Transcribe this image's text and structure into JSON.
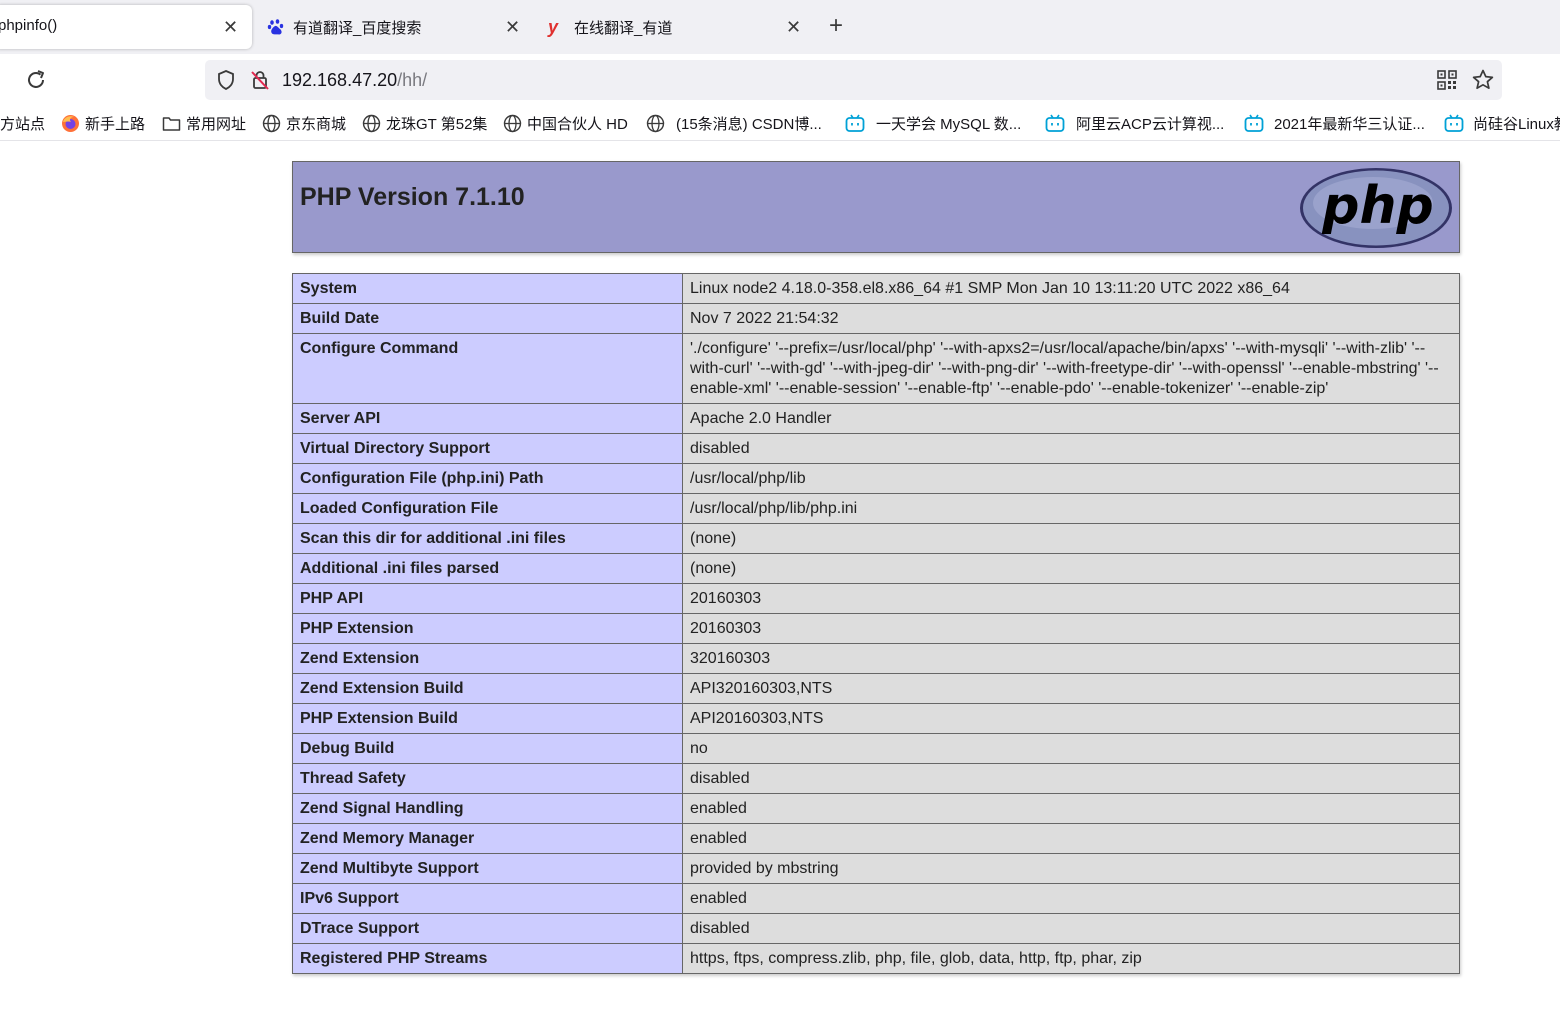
{
  "tabs": [
    {
      "title": "phpinfo()",
      "active": true
    },
    {
      "title": "有道翻译_百度搜索",
      "active": false
    },
    {
      "title": "在线翻译_有道",
      "active": false
    }
  ],
  "address": {
    "host": "192.168.47.20",
    "path": "/hh/"
  },
  "bookmarks": [
    {
      "label": "方站点",
      "icon": "none"
    },
    {
      "label": "新手上路",
      "icon": "firefox-icon"
    },
    {
      "label": "常用网址",
      "icon": "folder-icon"
    },
    {
      "label": "京东商城",
      "icon": "globe-icon"
    },
    {
      "label": "龙珠GT 第52集",
      "icon": "globe-icon"
    },
    {
      "label": "中国合伙人 HD",
      "icon": "globe-icon"
    },
    {
      "label": "(15条消息) CSDN博...",
      "icon": "globe-icon"
    },
    {
      "label": "一天学会 MySQL 数...",
      "icon": "bilibili-icon"
    },
    {
      "label": "阿里云ACP云计算视...",
      "icon": "bilibili-icon"
    },
    {
      "label": "2021年最新华三认证...",
      "icon": "bilibili-icon"
    },
    {
      "label": "尚硅谷Linux教",
      "icon": "bilibili-icon"
    }
  ],
  "php": {
    "title": "PHP Version 7.1.10",
    "logo_text": "php",
    "rows": [
      {
        "key": "System",
        "value": "Linux node2 4.18.0-358.el8.x86_64 #1 SMP Mon Jan 10 13:11:20 UTC 2022 x86_64"
      },
      {
        "key": "Build Date",
        "value": "Nov 7 2022 21:54:32"
      },
      {
        "key": "Configure Command",
        "value": "'./configure' '--prefix=/usr/local/php' '--with-apxs2=/usr/local/apache/bin/apxs' '--with-mysqli' '--with-zlib' '--with-curl' '--with-gd' '--with-jpeg-dir' '--with-png-dir' '--with-freetype-dir' '--with-openssl' '--enable-mbstring' '--enable-xml' '--enable-session' '--enable-ftp' '--enable-pdo' '--enable-tokenizer' '--enable-zip'"
      },
      {
        "key": "Server API",
        "value": "Apache 2.0 Handler"
      },
      {
        "key": "Virtual Directory Support",
        "value": "disabled"
      },
      {
        "key": "Configuration File (php.ini) Path",
        "value": "/usr/local/php/lib"
      },
      {
        "key": "Loaded Configuration File",
        "value": "/usr/local/php/lib/php.ini"
      },
      {
        "key": "Scan this dir for additional .ini files",
        "value": "(none)"
      },
      {
        "key": "Additional .ini files parsed",
        "value": "(none)"
      },
      {
        "key": "PHP API",
        "value": "20160303"
      },
      {
        "key": "PHP Extension",
        "value": "20160303"
      },
      {
        "key": "Zend Extension",
        "value": "320160303"
      },
      {
        "key": "Zend Extension Build",
        "value": "API320160303,NTS"
      },
      {
        "key": "PHP Extension Build",
        "value": "API20160303,NTS"
      },
      {
        "key": "Debug Build",
        "value": "no"
      },
      {
        "key": "Thread Safety",
        "value": "disabled"
      },
      {
        "key": "Zend Signal Handling",
        "value": "enabled"
      },
      {
        "key": "Zend Memory Manager",
        "value": "enabled"
      },
      {
        "key": "Zend Multibyte Support",
        "value": "provided by mbstring"
      },
      {
        "key": "IPv6 Support",
        "value": "enabled"
      },
      {
        "key": "DTrace Support",
        "value": "disabled"
      },
      {
        "key": "Registered PHP Streams",
        "value": "https, ftps, compress.zlib, php, file, glob, data, http, ftp, phar, zip"
      }
    ]
  },
  "colors": {
    "php_header": "#9999cc",
    "key_cell": "#ccccff",
    "value_cell": "#dddddd"
  }
}
